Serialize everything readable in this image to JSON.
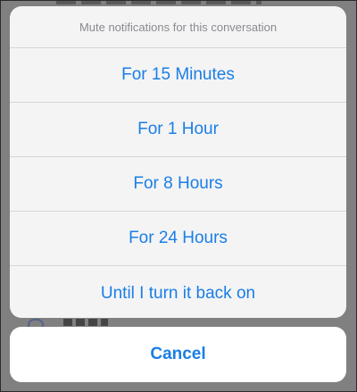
{
  "action_sheet": {
    "title": "Mute notifications for this conversation",
    "options": [
      {
        "label": "For 15 Minutes"
      },
      {
        "label": "For 1 Hour"
      },
      {
        "label": "For 8 Hours"
      },
      {
        "label": "For 24 Hours"
      },
      {
        "label": "Until I turn it back on"
      }
    ],
    "cancel_label": "Cancel"
  },
  "colors": {
    "accent": "#1a7ee6",
    "title_text": "#8a8a8f",
    "sheet_background": "#f4f4f5",
    "dim_overlay": "#808080"
  }
}
